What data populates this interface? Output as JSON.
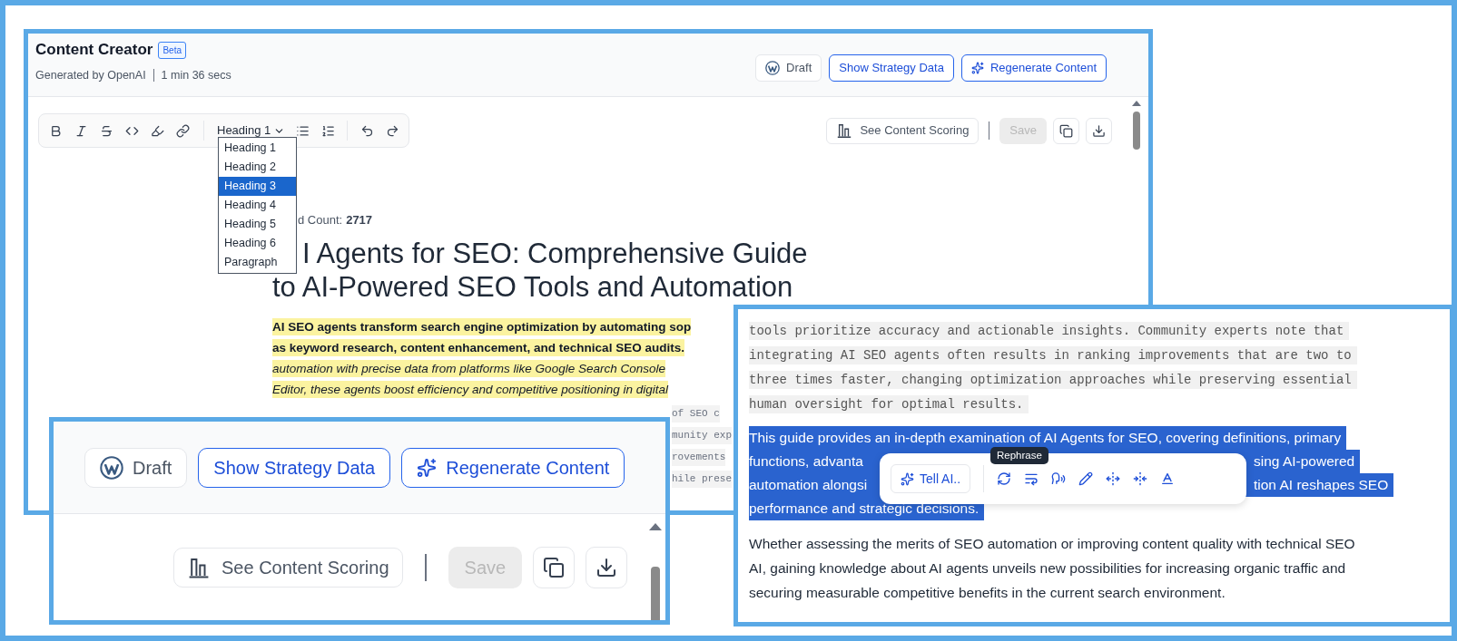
{
  "main": {
    "title": "Content Creator",
    "badge": "Beta",
    "generated_by": "Generated by OpenAI",
    "duration": "1 min 36 secs",
    "header_buttons": [
      {
        "kind": "wordpress",
        "label": "Draft"
      },
      {
        "kind": "outline",
        "label": "Show Strategy Data"
      },
      {
        "kind": "sparkle",
        "label": "Regenerate Content"
      }
    ],
    "format_select": "Heading 1",
    "format_options": [
      {
        "label": "Heading 1",
        "selected": false
      },
      {
        "label": "Heading 2",
        "selected": false
      },
      {
        "label": "Heading 3",
        "selected": true
      },
      {
        "label": "Heading 4",
        "selected": false
      },
      {
        "label": "Heading 5",
        "selected": false
      },
      {
        "label": "Heading 6",
        "selected": false
      },
      {
        "label": "Paragraph",
        "selected": false
      }
    ],
    "scoring_button": "See Content Scoring",
    "save_button": {
      "label": "Save",
      "disabled": true
    },
    "word_count": {
      "label": "d Count:",
      "value": "2717"
    },
    "title_lines": [
      "I Agents for SEO: Comprehensive Guide",
      "to AI-Powered SEO Tools and Automation"
    ],
    "intro_lines": [
      {
        "kind": "bold",
        "text": "AI SEO agents transform search engine optimization by automating sop"
      },
      {
        "kind": "bold",
        "text": "as keyword research, content enhancement, and technical SEO audits."
      },
      {
        "kind": "italic",
        "text": "automation with precise data from platforms like Google Search Console"
      },
      {
        "kind": "italic",
        "text": "Editor, these agents boost efficiency and competitive positioning in digital"
      }
    ],
    "code_fragments": [
      "of SEO c",
      "munity exp",
      "rovements",
      "hile prese"
    ]
  },
  "inset_toolbar": {
    "header_buttons": [
      {
        "kind": "wordpress",
        "label": "Draft"
      },
      {
        "kind": "outline",
        "label": "Show Strategy Data"
      },
      {
        "kind": "sparkle",
        "label": "Regenerate Content"
      }
    ],
    "scoring_button": "See Content Scoring",
    "save_button": {
      "label": "Save",
      "disabled": true
    }
  },
  "inset_text": {
    "code_lines": [
      "tools prioritize accuracy and actionable insights. Community experts note that",
      "integrating AI SEO agents often results in ranking improvements that are two to",
      "three times faster, changing optimization approaches while preserving essential",
      "human oversight for optimal results."
    ],
    "selected_lines": [
      {
        "left": "This guide provides an in-depth examination of AI Agents for SEO, covering definitions, primary"
      },
      {
        "left": "functions, advanta",
        "right": "sing AI-powered"
      },
      {
        "left": "automation alongsi",
        "right": "tion AI reshapes SEO"
      },
      {
        "left": "performance and strategic decisions."
      }
    ],
    "tooltip": "Rephrase",
    "ai_button": "Tell AI..",
    "paragraph": "Whether assessing the merits of SEO automation or improving content quality with technical SEO AI, gaining knowledge about AI agents unveils new possibilities for increasing organic traffic and securing measurable competitive benefits in the current search environment."
  }
}
